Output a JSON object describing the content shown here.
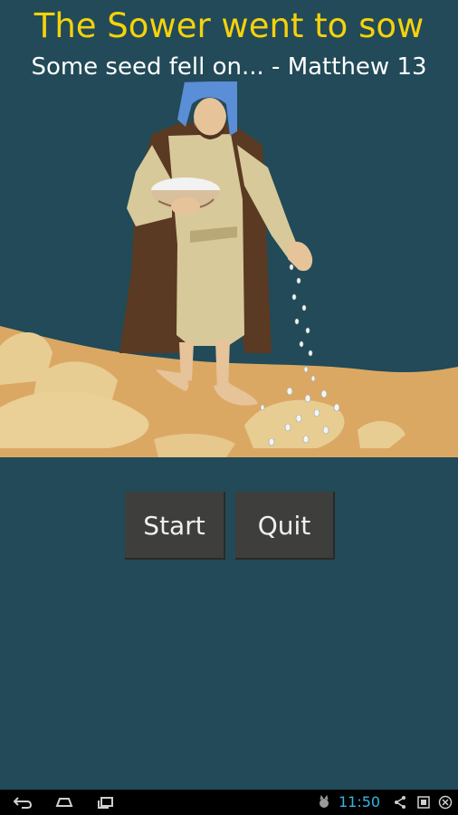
{
  "header": {
    "title": "The Sower went to sow",
    "subtitle": "Some seed fell on... - Matthew 13"
  },
  "menu": {
    "start_label": "Start",
    "quit_label": "Quit"
  },
  "status_bar": {
    "time": "11:50"
  },
  "colors": {
    "background": "#224a58",
    "title": "#f5d20b",
    "subtitle": "#ffffff",
    "button": "#3e3e3c",
    "clock": "#35b5e5"
  },
  "icons": [
    "back-icon",
    "home-icon",
    "recent-apps-icon",
    "cat-status-icon",
    "share-icon",
    "screenshot-icon",
    "close-circle-icon"
  ]
}
